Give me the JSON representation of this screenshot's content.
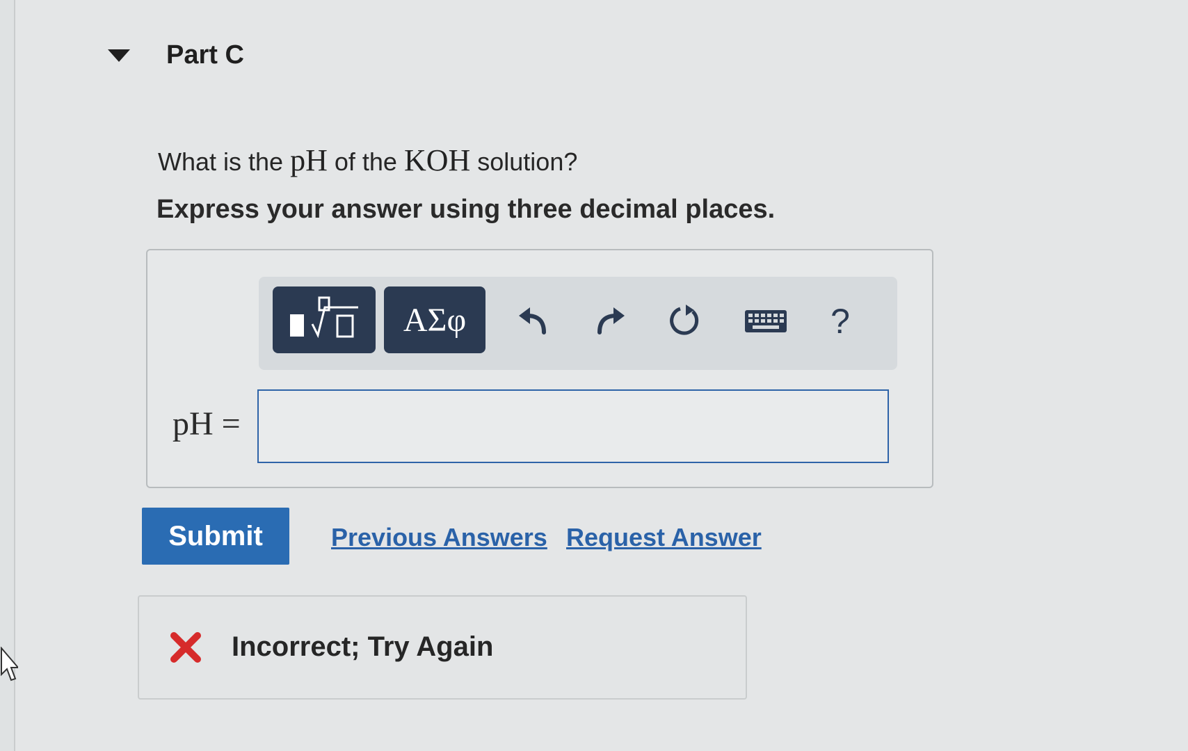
{
  "part": {
    "title": "Part C"
  },
  "question": {
    "prefix": "What is the",
    "math1": "pH",
    "middle": "of the",
    "math2": "KOH",
    "suffix": "solution?"
  },
  "instruction": "Express your answer using three decimal places.",
  "toolbar": {
    "template_icon": "fraction-radical-template-icon",
    "greek_label": "ΑΣφ",
    "undo_icon": "undo-icon",
    "redo_icon": "redo-icon",
    "reset_icon": "reset-icon",
    "keyboard_icon": "keyboard-icon",
    "help_label": "?"
  },
  "answer": {
    "label": "pH =",
    "value": ""
  },
  "actions": {
    "submit_label": "Submit",
    "previous_answers": "Previous Answers",
    "request_answer": "Request Answer"
  },
  "feedback": {
    "text": "Incorrect; Try Again",
    "icon": "red-x-icon"
  },
  "colors": {
    "accent": "#2a6cb3",
    "toolbar_dark": "#2b3a52",
    "link": "#2a62a8",
    "error": "#d62b2b"
  }
}
